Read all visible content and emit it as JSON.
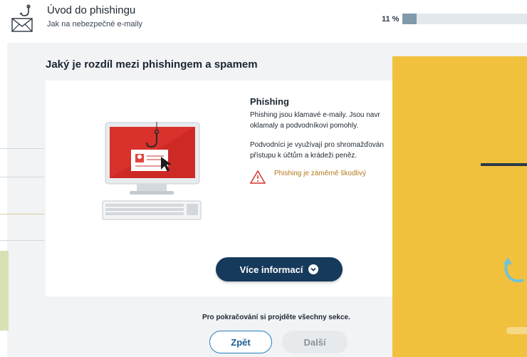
{
  "header": {
    "title": "Úvod do phishingu",
    "subtitle": "Jak na nebezpečné e-maily",
    "progress_label": "11 %",
    "progress_value": 0.11
  },
  "section": {
    "title": "Jaký je rozdíl mezi phishingem a spamem"
  },
  "card": {
    "heading": "Phishing",
    "paragraph1": "Phishing jsou klamavé e-maily. Jsou navr oklamaly a podvodníkovi pomohly.",
    "paragraph2": "Podvodníci je využívají pro shromažďován přístupu k účtům a krádeži peněz.",
    "warning": "Phishing je záměrně škodlivý",
    "more_button": "Více informací"
  },
  "footer": {
    "note": "Pro pokračování si projděte všechny sekce.",
    "back_button": "Zpět",
    "next_button": "Další"
  },
  "colors": {
    "accent_dark": "#163a5c",
    "accent_blue": "#2a7fc0",
    "warning": "#b27a1a",
    "overlay_yellow": "#f1c13e",
    "monitor_red": "#d9312b"
  },
  "icons": {
    "logo": "envelope-fishhook-icon",
    "warning": "warning-triangle-icon",
    "chevron": "chevron-down-circle-icon"
  }
}
